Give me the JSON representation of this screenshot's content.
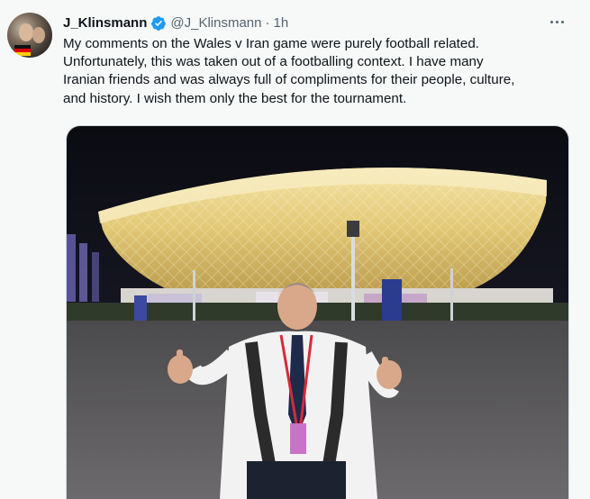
{
  "tweet": {
    "author_name": "J_Klinsmann",
    "handle": "@J_Klinsmann",
    "separator": "·",
    "time": "1h",
    "text": "My comments on the Wales v Iran game were purely football related.\nUnfortunately, this was taken out of a footballing context. I have many\nIranian friends and was always full of compliments for their people, culture,\nand history. I wish them only the best for the tournament.",
    "verified_icon": "verified-badge-icon",
    "more_icon": "more-options-icon"
  },
  "colors": {
    "background": "#f7f9f9",
    "text": "#0f1419",
    "secondary": "#536471",
    "verified": "#1d9bf0"
  }
}
